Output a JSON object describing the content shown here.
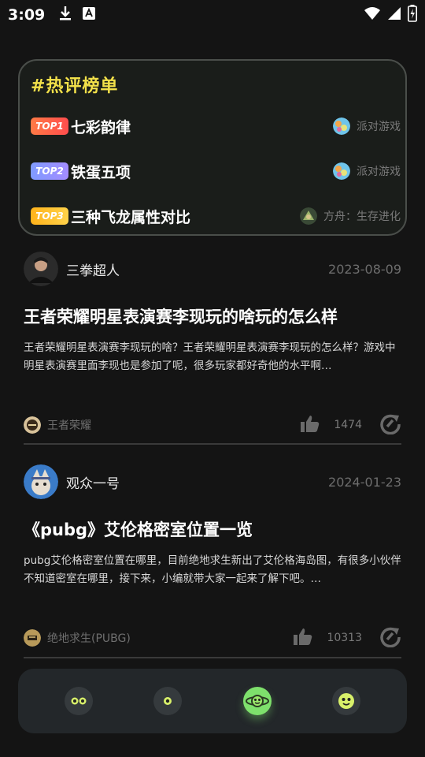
{
  "status_bar": {
    "time": "3:09"
  },
  "hot_list": {
    "title": "#热评榜单",
    "items": [
      {
        "rank": "TOP1",
        "name": "七彩韵律",
        "game": "派对游戏"
      },
      {
        "rank": "TOP2",
        "name": "铁蛋五项",
        "game": "派对游戏"
      },
      {
        "rank": "TOP3",
        "name": "三种飞龙属性对比",
        "game": "方舟：生存进化"
      }
    ]
  },
  "posts": [
    {
      "author": "三拳超人",
      "date": "2023-08-09",
      "title": "王者荣耀明星表演赛李现玩的啥玩的怎么样",
      "excerpt": "王者荣耀明星表演赛李现玩的啥？王者荣耀明星表演赛李现玩的怎么样？游戏中明星表演赛里面李现也是参加了呢，很多玩家都好奇他的水平啊…",
      "game": "王者荣耀",
      "likes": "1474"
    },
    {
      "author": "观众一号",
      "date": "2024-01-23",
      "title": "《pubg》艾伦格密室位置一览",
      "excerpt": "pubg艾伦格密室位置在哪里，目前绝地求生新出了艾伦格海岛图，有很多小伙伴不知道密室在哪里，接下来，小编就带大家一起来了解下吧。…",
      "game": "绝地求生(PUBG)",
      "likes": "10313"
    }
  ],
  "nav": {
    "items": [
      {
        "icon": "eyes-face-icon"
      },
      {
        "icon": "dot-icon"
      },
      {
        "icon": "planet-icon",
        "active": true
      },
      {
        "icon": "smile-face-icon"
      }
    ],
    "accent": "#7ee06c"
  },
  "colors": {
    "background": "#141414",
    "hot_title": "#f2e04a"
  }
}
